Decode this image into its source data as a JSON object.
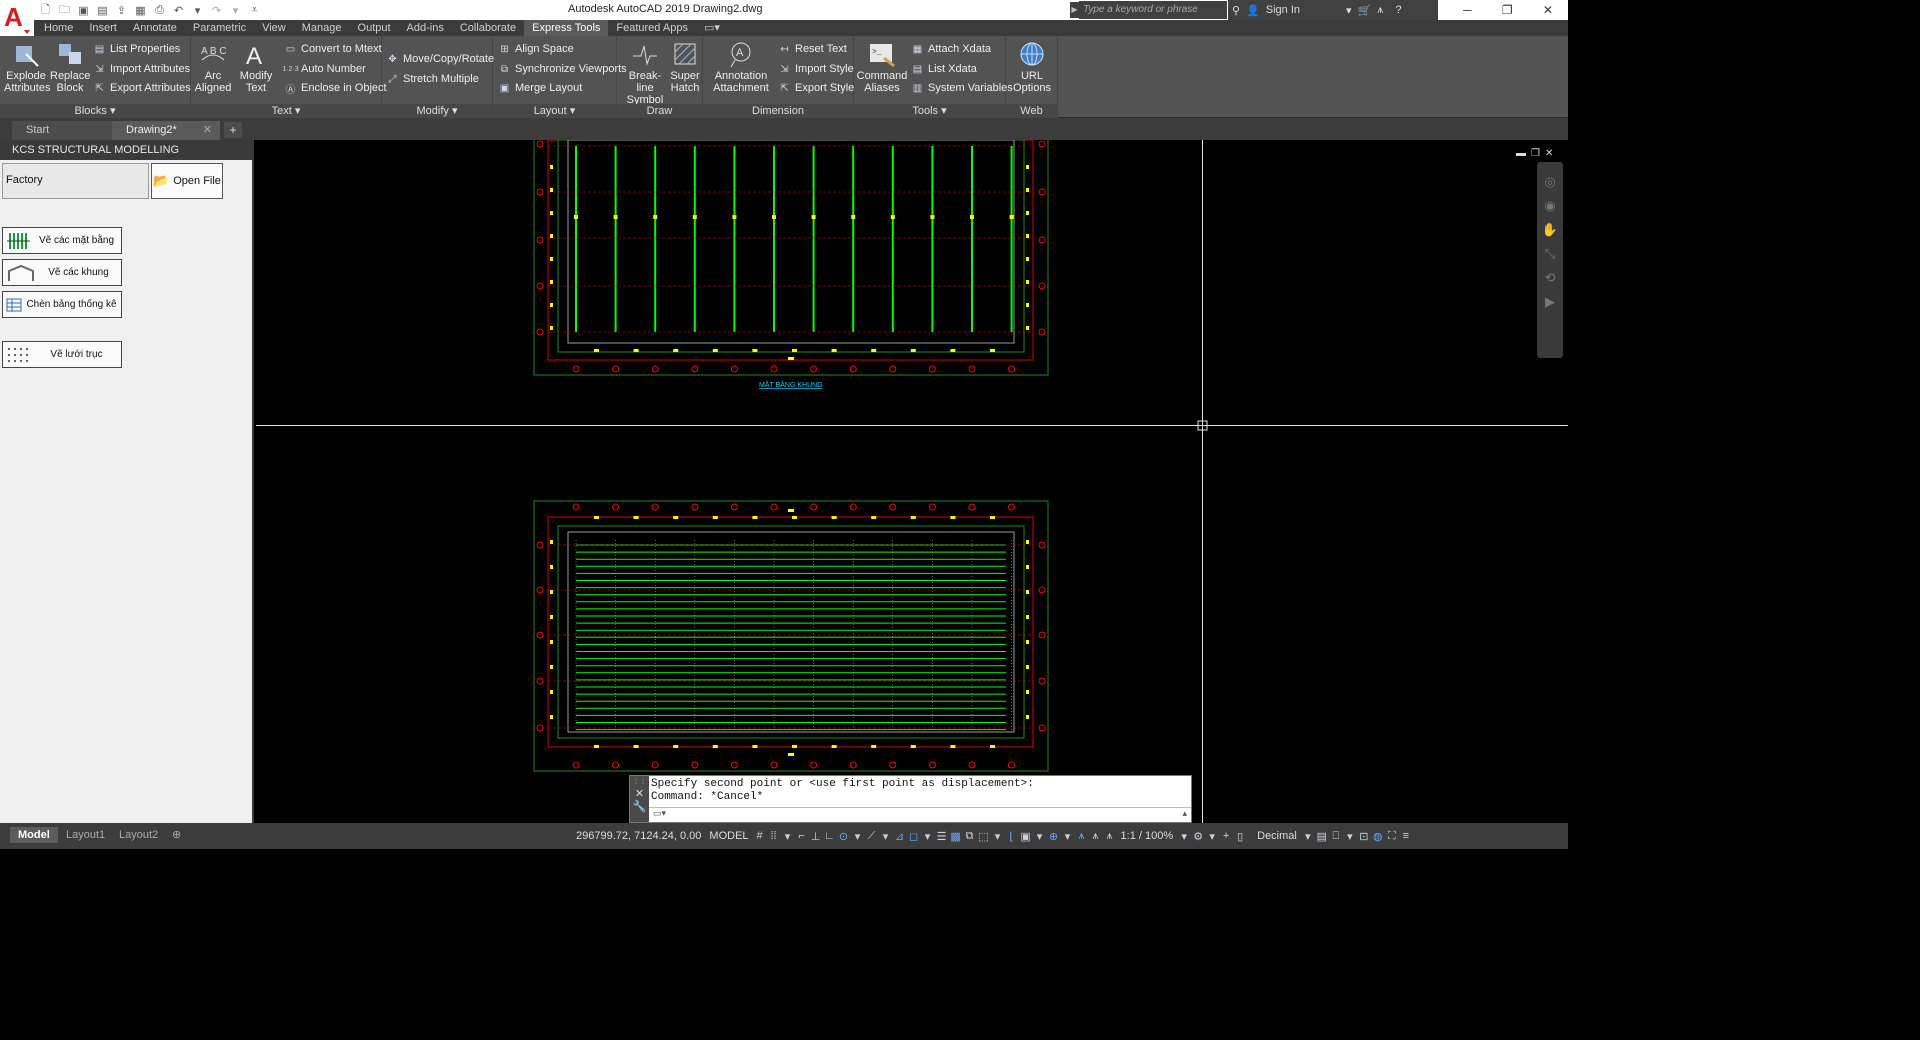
{
  "app": {
    "title": "Autodesk AutoCAD 2019    Drawing2.dwg",
    "search_placeholder": "Type a keyword or phrase",
    "signin_label": "Sign In"
  },
  "ribbon_tabs": [
    "Home",
    "Insert",
    "Annotate",
    "Parametric",
    "View",
    "Manage",
    "Output",
    "Add-ins",
    "Collaborate",
    "Express Tools",
    "Featured Apps"
  ],
  "active_ribbon_tab": "Express Tools",
  "ribbon": {
    "blocks": {
      "title": "Blocks",
      "explode_attributes": [
        "Explode",
        "Attributes"
      ],
      "replace_block": [
        "Replace",
        "Block"
      ],
      "list_properties": "List Properties",
      "import_attributes": "Import Attributes",
      "export_attributes": "Export Attributes"
    },
    "text": {
      "title": "Text",
      "arc_aligned": [
        "Arc",
        "Aligned"
      ],
      "modify_text": [
        "Modify",
        "Text"
      ],
      "convert_to_mtext": "Convert to Mtext",
      "auto_number": "Auto Number",
      "enclose_in_object": "Enclose in Object"
    },
    "modify": {
      "title": "Modify",
      "move_copy_rotate": "Move/Copy/Rotate",
      "stretch_multiple": "Stretch Multiple"
    },
    "layout": {
      "title": "Layout",
      "align_space": "Align Space",
      "synchronize_viewports": "Synchronize Viewports",
      "merge_layout": "Merge Layout"
    },
    "draw": {
      "title": "Draw",
      "breakline_symbol": [
        "Break-line",
        "Symbol"
      ],
      "super_hatch": [
        "Super",
        "Hatch"
      ]
    },
    "dimension": {
      "title": "Dimension",
      "annotation_attachment": [
        "Annotation",
        "Attachment"
      ],
      "reset_text": "Reset Text",
      "import_style": "Import Style",
      "export_style": "Export Style"
    },
    "tools": {
      "title": "Tools",
      "command_aliases": [
        "Command",
        "Aliases"
      ],
      "attach_xdata": "Attach Xdata",
      "list_xdata": "List Xdata",
      "system_variables": "System Variables"
    },
    "web": {
      "title": "Web",
      "url_options": [
        "URL",
        "Options"
      ]
    }
  },
  "file_tabs": [
    "Start",
    "Drawing2*"
  ],
  "palette": {
    "title": "KCS STRUCTURAL MODELLING",
    "factory_value": "Factory",
    "open_file": "Open File",
    "buttons": [
      "Vẽ các mặt bằng",
      "Vẽ các khung",
      "Chèn bảng thống kê",
      "Vẽ lưới trục"
    ]
  },
  "drawing": {
    "plan_label": "MẶT BẰNG KHUNG"
  },
  "command_line": {
    "history": [
      "Specify second point or <use first point as displacement>:",
      "Command: *Cancel*"
    ]
  },
  "layout_tabs": [
    "Model",
    "Layout1",
    "Layout2"
  ],
  "status": {
    "coordinates": "296799.72, 7124.24, 0.00",
    "space": "MODEL",
    "scale": "1:1 / 100%",
    "units": "Decimal"
  },
  "colors": {
    "ribbon_bg": "#535353",
    "drawing_green": "#00ff00",
    "drawing_red": "#ff0000",
    "drawing_yellow": "#ffff00"
  }
}
